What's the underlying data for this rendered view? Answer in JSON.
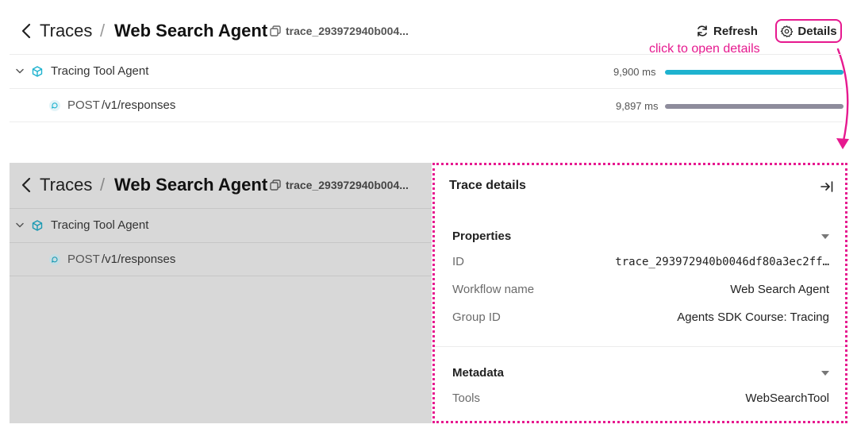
{
  "breadcrumb": {
    "traces": "Traces",
    "separator": "/",
    "agent": "Web Search Agent",
    "trace_id": "trace_293972940b004..."
  },
  "toolbar": {
    "refresh_label": "Refresh",
    "details_label": "Details"
  },
  "annotation": "click to open details",
  "spans": [
    {
      "method": "",
      "name": "Tracing Tool Agent",
      "duration": "9,900 ms",
      "progress": 1.0,
      "color": "#1eb2cf"
    },
    {
      "method": "POST",
      "name": "/v1/responses",
      "duration": "9,897 ms",
      "progress": 0.9997,
      "color": "#8e8c9c"
    }
  ],
  "details_panel": {
    "title": "Trace details",
    "properties_heading": "Properties",
    "properties": [
      {
        "key": "ID",
        "value": "trace_293972940b0046df80a3ec2ff…"
      },
      {
        "key": "Workflow name",
        "value": "Web Search Agent"
      },
      {
        "key": "Group ID",
        "value": "Agents SDK Course: Tracing"
      }
    ],
    "metadata_heading": "Metadata",
    "metadata": [
      {
        "key": "Tools",
        "value": "WebSearchTool"
      }
    ]
  },
  "colors": {
    "accent": "#e6198f",
    "agent_bar": "#1eb2cf",
    "response_bar": "#8e8c9c",
    "overlay": "#d8d8d8"
  }
}
